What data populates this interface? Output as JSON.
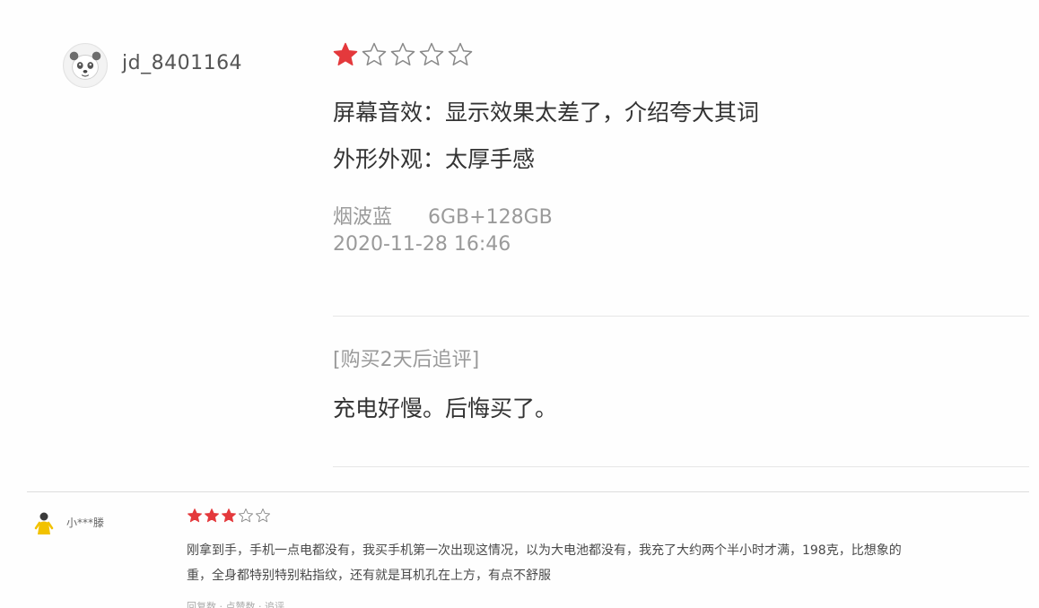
{
  "colors": {
    "star_filled": "#e4393c",
    "star_empty_stroke": "#888888",
    "text_primary": "#333333",
    "text_secondary": "#9a9a9a",
    "divider": "#e6e6e6"
  },
  "review1": {
    "avatar_icon": "panda-avatar-icon",
    "username": "jd_8401164",
    "rating": 1,
    "rating_max": 5,
    "lines": [
      "屏幕音效：显示效果太差了，介绍夸大其词",
      "外形外观：太厚手感"
    ],
    "color_variant": "烟波蓝",
    "spec": "6GB+128GB",
    "date": "2020-11-28 16:46",
    "append": {
      "label": "[购买2天后追评]",
      "text": "充电好慢。后悔买了。"
    }
  },
  "review2": {
    "avatar_icon": "user-figure-icon",
    "username": "小***滕",
    "rating": 3,
    "rating_max": 5,
    "lines": [
      "刚拿到手，手机一点电都没有，我买手机第一次出现这情况，以为大电池都没有，我充了大约两个半小时才满，198克，比想象的",
      "重，全身都特别特别粘指纹，还有就是耳机孔在上方，有点不舒服"
    ],
    "meta_partial": "回复数 · 点赞数 · 追评"
  }
}
